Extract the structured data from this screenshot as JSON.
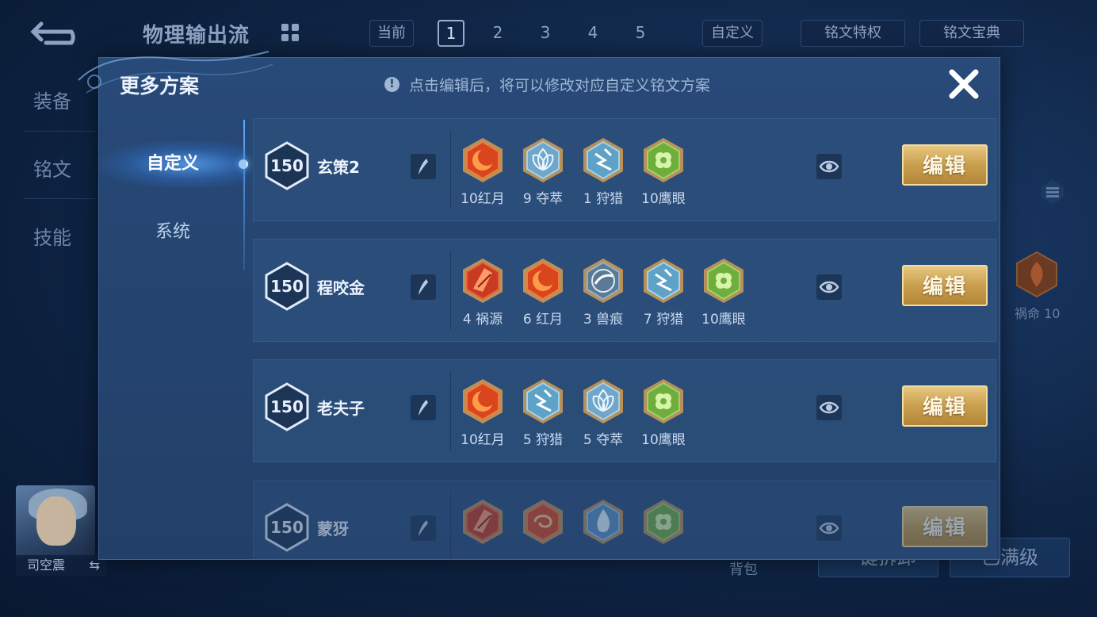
{
  "background": {
    "title": "物理输出流",
    "current_label": "当前",
    "page_numbers": [
      "1",
      "2",
      "3",
      "4",
      "5"
    ],
    "active_page": "1",
    "custom_label": "自定义",
    "privilege_label": "铭文特权",
    "treasury_label": "铭文宝典",
    "side_tabs": [
      "装备",
      "铭文",
      "技能"
    ],
    "hero_name": "司空震",
    "right_rune_label": "祸命 10",
    "bag_label": "背包",
    "bottom_btn_1": "一键拆卸",
    "bottom_btn_2": "已满级"
  },
  "modal": {
    "title": "更多方案",
    "notice": "点击编辑后，将可以修改对应自定义铭文方案",
    "nav": [
      "自定义",
      "系统"
    ],
    "edit_label": "编辑",
    "plans": [
      {
        "level": "150",
        "name": "玄策2",
        "runes": [
          {
            "type": "red-moon",
            "label": "10红月"
          },
          {
            "type": "seize",
            "label": "9 夺萃"
          },
          {
            "type": "hunt",
            "label": "1 狩猎"
          },
          {
            "type": "hawk-eye",
            "label": "10鹰眼"
          }
        ]
      },
      {
        "level": "150",
        "name": "程咬金",
        "runes": [
          {
            "type": "calamity",
            "label": "4 祸源"
          },
          {
            "type": "red-moon",
            "label": "6 红月"
          },
          {
            "type": "beast-mark",
            "label": "3 兽痕"
          },
          {
            "type": "hunt",
            "label": "7 狩猎"
          },
          {
            "type": "hawk-eye",
            "label": "10鹰眼"
          }
        ]
      },
      {
        "level": "150",
        "name": "老夫子",
        "runes": [
          {
            "type": "red-moon",
            "label": "10红月"
          },
          {
            "type": "hunt",
            "label": "5 狩猎"
          },
          {
            "type": "seize",
            "label": "5 夺萃"
          },
          {
            "type": "hawk-eye",
            "label": "10鹰眼"
          }
        ]
      },
      {
        "level": "150",
        "name": "蒙犽",
        "runes": [
          {
            "type": "calamity",
            "label": ""
          },
          {
            "type": "red-swirl",
            "label": ""
          },
          {
            "type": "blue-flame",
            "label": ""
          },
          {
            "type": "hawk-eye",
            "label": ""
          }
        ]
      }
    ]
  },
  "colors": {
    "gold": "#c99f4e",
    "red_rune": "#d9461d",
    "blue_rune": "#7fb8d8",
    "green_rune": "#7fc24a"
  }
}
